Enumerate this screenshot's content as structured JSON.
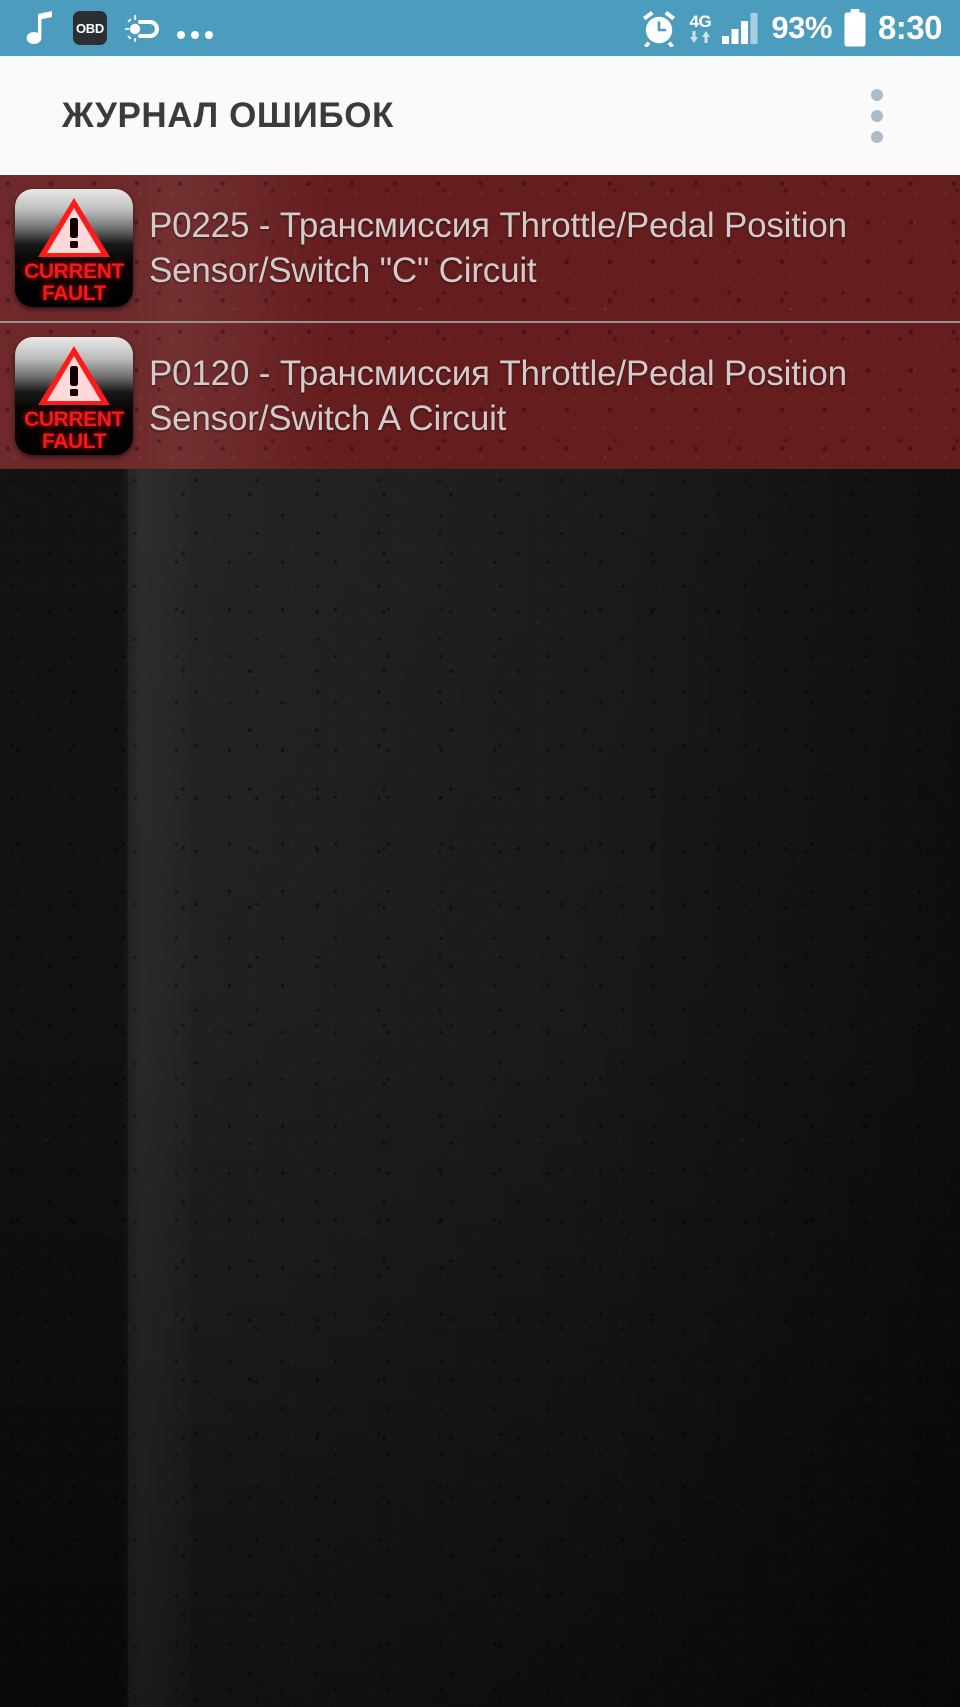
{
  "status_bar": {
    "background_color": "#4c9cbd",
    "left_icons": [
      {
        "name": "music-note-icon",
        "label": "music"
      },
      {
        "name": "obd-badge-icon",
        "label": "OBD"
      },
      {
        "name": "weather-icon",
        "label": "partly-sunny"
      },
      {
        "name": "more-notifications-icon",
        "label": "..."
      }
    ],
    "right_icons": [
      {
        "name": "alarm-clock-icon",
        "label": "alarm"
      },
      {
        "name": "network-type-icon",
        "label": "4G"
      },
      {
        "name": "signal-bars-icon",
        "label": "signal"
      },
      {
        "name": "battery-icon",
        "label": "battery"
      }
    ],
    "battery_percent": "93%",
    "network_label": "4G",
    "clock": "8:30"
  },
  "toolbar": {
    "title": "ЖУРНАЛ ОШИБОК",
    "background_color": "#fafafa",
    "title_color": "#3b3b3b",
    "overflow_label": "⋮"
  },
  "fault_list": {
    "row_color": "#661d1e",
    "text_color": "#d3cbcb",
    "items": [
      {
        "code": "P0225",
        "badge_line1": "CURRENT",
        "badge_line2": "FAULT",
        "badge_name": "current-fault-icon",
        "text": "P0225 - Трансмиссия Throttle/Pedal Position Sensor/Switch \"C\" Circuit"
      },
      {
        "code": "P0120",
        "badge_line1": "CURRENT",
        "badge_line2": "FAULT",
        "badge_name": "current-fault-icon",
        "text": "P0120 - Трансмиссия Throttle/Pedal Position Sensor/Switch A Circuit"
      }
    ]
  },
  "background": {
    "description": "dark textured concrete wallpaper",
    "color": "#181818"
  }
}
